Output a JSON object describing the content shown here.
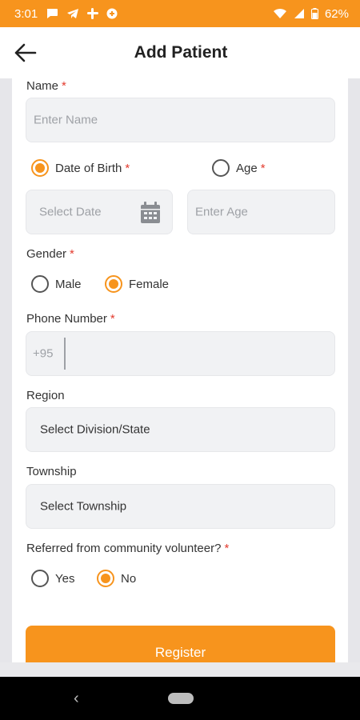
{
  "status_bar": {
    "time": "3:01",
    "battery": "62%",
    "icons": [
      "chat-icon",
      "telegram-icon",
      "slack-icon",
      "circle-app-icon",
      "wifi-icon",
      "signal-icon",
      "battery-icon"
    ]
  },
  "app_bar": {
    "title": "Add Patient",
    "back_icon": "arrow-left-icon"
  },
  "form": {
    "name": {
      "label": "Name",
      "placeholder": "Enter Name"
    },
    "dob_option": {
      "label": "Date of Birth",
      "selected": true
    },
    "age_option": {
      "label": "Age",
      "selected": false
    },
    "date_field": {
      "placeholder": "Select Date",
      "icon": "calendar-icon"
    },
    "age_field": {
      "placeholder": "Enter Age"
    },
    "gender": {
      "label": "Gender",
      "options": [
        {
          "label": "Male",
          "selected": false
        },
        {
          "label": "Female",
          "selected": true
        }
      ]
    },
    "phone": {
      "label": "Phone Number",
      "prefix": "+95",
      "value": ""
    },
    "region": {
      "label": "Region",
      "value": "Select Division/State"
    },
    "township": {
      "label": "Township",
      "value": "Select Township"
    },
    "referred": {
      "label": "Referred from community volunteer?",
      "options": [
        {
          "label": "Yes",
          "selected": false
        },
        {
          "label": "No",
          "selected": true
        }
      ]
    },
    "required_mark": "*",
    "submit_label": "Register"
  },
  "colors": {
    "accent": "#f7941d",
    "required": "#e33b2e",
    "field_bg": "#f1f2f4"
  }
}
